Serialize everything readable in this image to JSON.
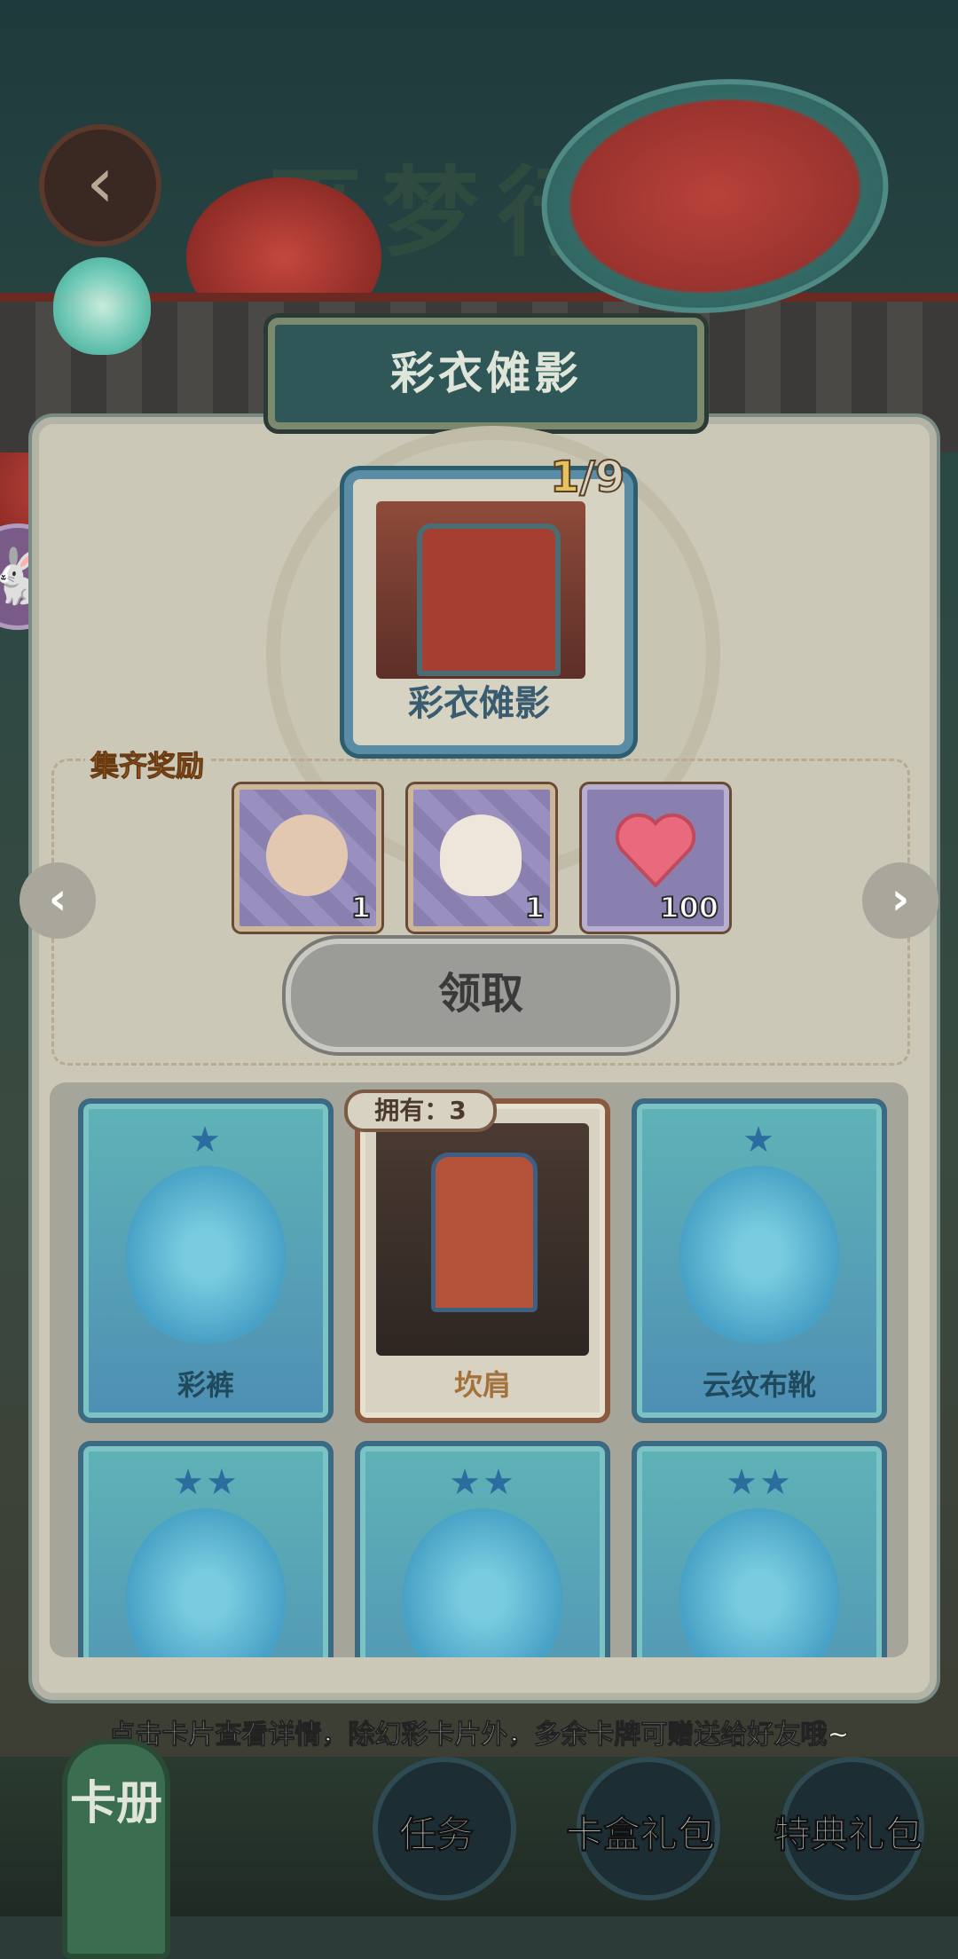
{
  "header": {
    "bg_title": "巫梦行",
    "back_icon": "back-arrow-icon",
    "banner_title": "彩衣傩影"
  },
  "collection": {
    "progress_current": "1",
    "progress_total": "/9",
    "main_card_label": "彩衣傩影"
  },
  "rewards": {
    "label": "集齐奖励",
    "items": [
      {
        "icon": "cape-icon",
        "count": "1"
      },
      {
        "icon": "hairstyle-icon",
        "count": "1"
      },
      {
        "icon": "heart-icon",
        "count": "100"
      }
    ],
    "claim_label": "领取"
  },
  "cards": {
    "owned_tag": "拥有：3",
    "items": [
      {
        "name": "彩裤",
        "stars": "★",
        "owned": false
      },
      {
        "name": "坎肩",
        "stars": "★",
        "owned": true
      },
      {
        "name": "云纹布靴",
        "stars": "★",
        "owned": false
      },
      {
        "name": "",
        "stars": "★★",
        "owned": false
      },
      {
        "name": "",
        "stars": "★★",
        "owned": false
      },
      {
        "name": "",
        "stars": "★★",
        "owned": false
      }
    ]
  },
  "tip": "点击卡片查看详情，除幻彩卡片外，多余卡牌可赠送给好友哦~",
  "bottom_nav": {
    "album": "卡册",
    "task": "任务",
    "card_box": "卡盒礼包",
    "special": "特典礼包"
  }
}
